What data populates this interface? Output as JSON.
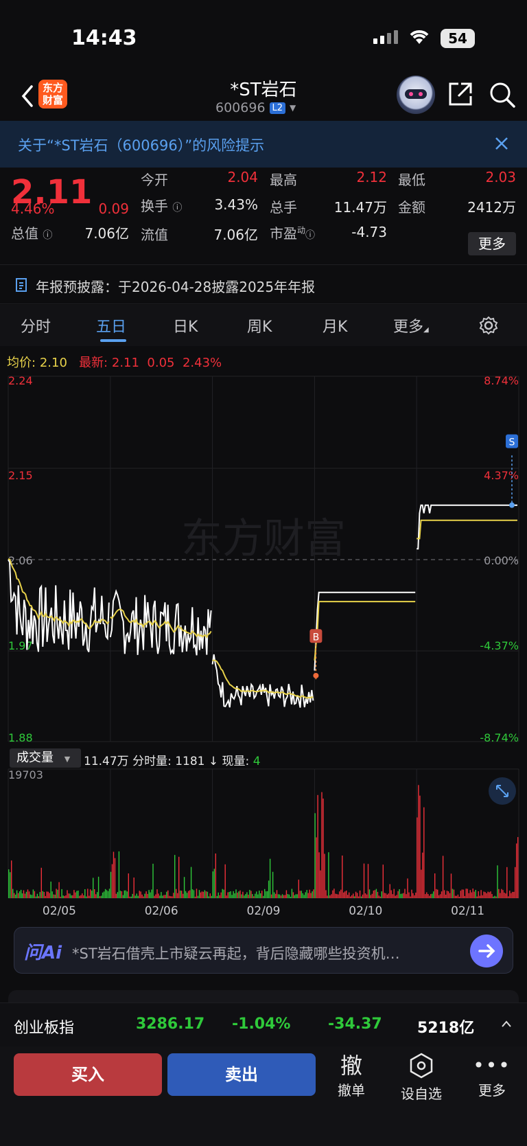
{
  "status": {
    "time": "14:43",
    "battery": "54"
  },
  "header": {
    "logo_line1": "东方",
    "logo_line2": "财富",
    "title": "*ST岩石",
    "code": "600696",
    "badge": "L2"
  },
  "risk": {
    "text": "关于“*ST岩石（600696）”的风险提示"
  },
  "quote": {
    "price": "2.11",
    "pct": "4.46%",
    "chg": "0.09",
    "open_label": "今开",
    "open": "2.04",
    "high_label": "最高",
    "high": "2.12",
    "low_label": "最低",
    "low": "2.03",
    "turnover_label": "换手",
    "turnover": "3.43%",
    "vol_label": "总手",
    "vol": "11.47万",
    "amount_label": "金额",
    "amount": "2412万",
    "mcap_label": "总值",
    "mcap": "7.06亿",
    "float_label": "流值",
    "float": "7.06亿",
    "pe_label": "市盈",
    "pe_sup": "动",
    "pe": "-4.73",
    "more": "更多"
  },
  "notice": {
    "text": "年报预披露：于2026-04-28披露2025年年报"
  },
  "tabs": [
    "分时",
    "五日",
    "日K",
    "周K",
    "月K",
    "更多"
  ],
  "avg": {
    "avg_label": "均价:",
    "avg": "2.10",
    "latest_label": "最新:",
    "latest": "2.11",
    "chg": "0.05",
    "pct": "2.43%"
  },
  "chart_data": {
    "type": "line",
    "title": "",
    "series": [
      {
        "name": "",
        "values": []
      }
    ],
    "price_ticks": [
      "2.24",
      "2.15",
      "2.06",
      "1.97",
      "1.88"
    ],
    "pct_ticks": [
      "8.74%",
      "4.37%",
      "0.00%",
      "-4.37%",
      "-8.74%"
    ],
    "ylim": [
      1.88,
      2.24
    ],
    "x_ticks": [
      "02/05",
      "02/06",
      "02/09",
      "02/10",
      "02/11"
    ],
    "vol_max_label": "19703",
    "markers": {
      "buy": "B",
      "sell": "S"
    },
    "colors": {
      "price": "#ffffff",
      "avg": "#e8d24a",
      "up": "#f0303a",
      "down": "#2fc93a"
    }
  },
  "volume": {
    "selector": "成交量",
    "total": "11.47万",
    "minute_label": "分时量:",
    "minute": "1181",
    "arrow": "↓",
    "now_label": "现量:",
    "now": "4"
  },
  "ai": {
    "logo": "问Ai",
    "text": "*ST岩石借壳上市疑云再起，背后隐藏哪些投资机…"
  },
  "index": {
    "name": "创业板指",
    "value": "3286.17",
    "pct": "-1.04%",
    "chg": "-34.37",
    "amount": "5218亿"
  },
  "bottom": {
    "buy": "买入",
    "sell": "卖出",
    "cancel_icon": "撤",
    "cancel": "撤单",
    "custom": "设自选",
    "more": "更多"
  }
}
